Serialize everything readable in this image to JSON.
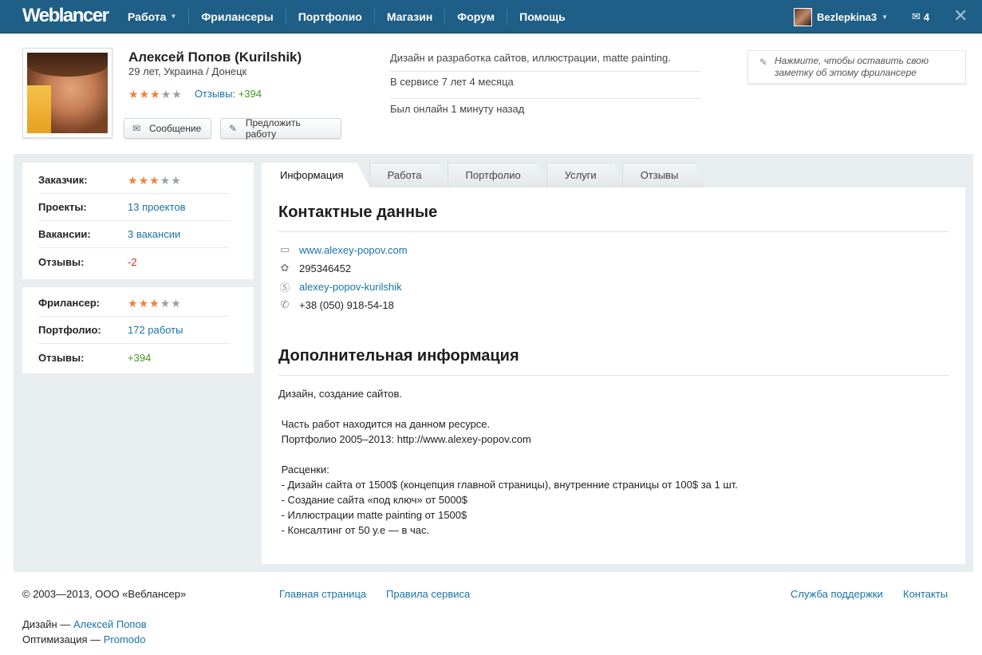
{
  "nav": {
    "logo": "Weblancer",
    "items": [
      {
        "label": "Работа",
        "dropdown": true
      },
      {
        "label": "Фрилансеры"
      },
      {
        "label": "Портфолио"
      },
      {
        "label": "Магазин"
      },
      {
        "label": "Форум"
      },
      {
        "label": "Помощь"
      }
    ],
    "user": "Bezlepkina3",
    "mail_count": "4"
  },
  "profile": {
    "name": "Алексей Попов (Kurilshik)",
    "meta": "29 лет, Украина / Донецк",
    "rating_stars": 3,
    "reviews_label": "Отзывы:",
    "reviews_value": "+394",
    "message_button": "Сообщение",
    "offer_button": "Предложить работу",
    "info": [
      "Дизайн и разработка сайтов, иллюстрации, matte painting.",
      "В сервисе 7 лет 4 месяца",
      "Был онлайн 1 минуту назад"
    ],
    "note": "Нажмите, чтобы оставить свою заметку об этому фрилансере"
  },
  "sidebar": {
    "customer": {
      "label": "Заказчик:",
      "rating_stars": 3,
      "projects_label": "Проекты:",
      "projects_value": "13 проектов",
      "vacancies_label": "Вакансии:",
      "vacancies_value": "3 вакансии",
      "reviews_label": "Отзывы:",
      "reviews_value": "-2"
    },
    "freelancer": {
      "label": "Фрилансер:",
      "rating_stars": 3,
      "portfolio_label": "Портфолио:",
      "portfolio_value": "172 работы",
      "reviews_label": "Отзывы:",
      "reviews_value": "+394"
    }
  },
  "tabs": [
    "Информация",
    "Работа",
    "Портфолио",
    "Услуги",
    "Отзывы"
  ],
  "contacts": {
    "title": "Контактные данные",
    "website": "www.alexey-popov.com",
    "icq": "295346452",
    "skype": "alexey-popov-kurilshik",
    "phone": "+38 (050) 918-54-18"
  },
  "additional": {
    "title": "Дополнительная информация",
    "text": "Дизайн, создание сайтов.\n\n Часть работ находится на данном ресурсе.\n Портфолио 2005–2013: http://www.alexey-popov.com\n\n Расценки:\n - Дизайн сайта от 1500$ (концепция главной страницы), внутренние страницы от 100$ за 1 шт.\n - Создание сайта «под ключ» от 5000$\n - Иллюстрации matte painting от 1500$\n - Консалтинг от 50 у.е — в час."
  },
  "footer": {
    "copyright": "© 2003—2013, ООО «Веблансер»",
    "home": "Главная страница",
    "rules": "Правила сервиса",
    "support": "Служба поддержки",
    "contacts": "Контакты",
    "design_label": "Дизайн —",
    "design_author": "Алексей Попов",
    "optim_label": "Оптимизация —",
    "optim_author": "Promodo"
  },
  "colors": {
    "topbar": "#1f5e86",
    "link": "#1a73a8",
    "positive": "#3f9a1b",
    "negative": "#d02d1c",
    "star": "#f0813a"
  }
}
